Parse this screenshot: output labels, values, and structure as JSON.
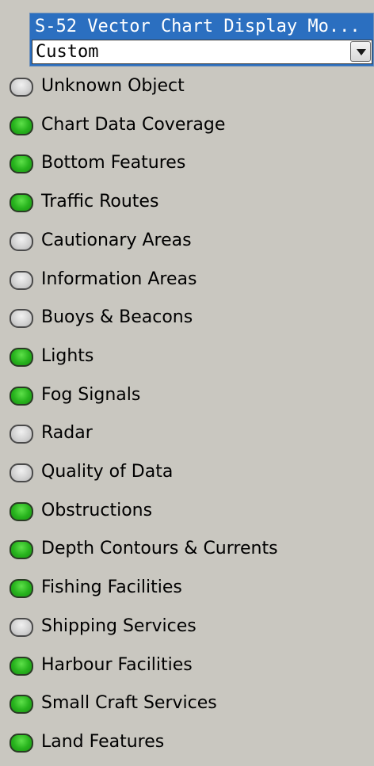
{
  "mode": {
    "title": "S-52 Vector Chart Display Mo...",
    "value": "Custom"
  },
  "layers": [
    {
      "label": "Unknown Object",
      "on": false
    },
    {
      "label": "Chart Data Coverage",
      "on": true
    },
    {
      "label": "Bottom Features",
      "on": true
    },
    {
      "label": "Traffic Routes",
      "on": true
    },
    {
      "label": "Cautionary Areas",
      "on": false
    },
    {
      "label": "Information Areas",
      "on": false
    },
    {
      "label": "Buoys & Beacons",
      "on": false
    },
    {
      "label": "Lights",
      "on": true
    },
    {
      "label": "Fog Signals",
      "on": true
    },
    {
      "label": "Radar",
      "on": false
    },
    {
      "label": "Quality of Data",
      "on": false
    },
    {
      "label": "Obstructions",
      "on": true
    },
    {
      "label": "Depth Contours & Currents",
      "on": true
    },
    {
      "label": "Fishing Facilities",
      "on": true
    },
    {
      "label": "Shipping Services",
      "on": false
    },
    {
      "label": "Harbour Facilities",
      "on": true
    },
    {
      "label": "Small Craft Services",
      "on": true
    },
    {
      "label": "Land Features",
      "on": true
    }
  ],
  "colors": {
    "toggle_on": "#27b31d",
    "toggle_off": "#d0d0d0",
    "header_bg": "#2b6fc0"
  }
}
